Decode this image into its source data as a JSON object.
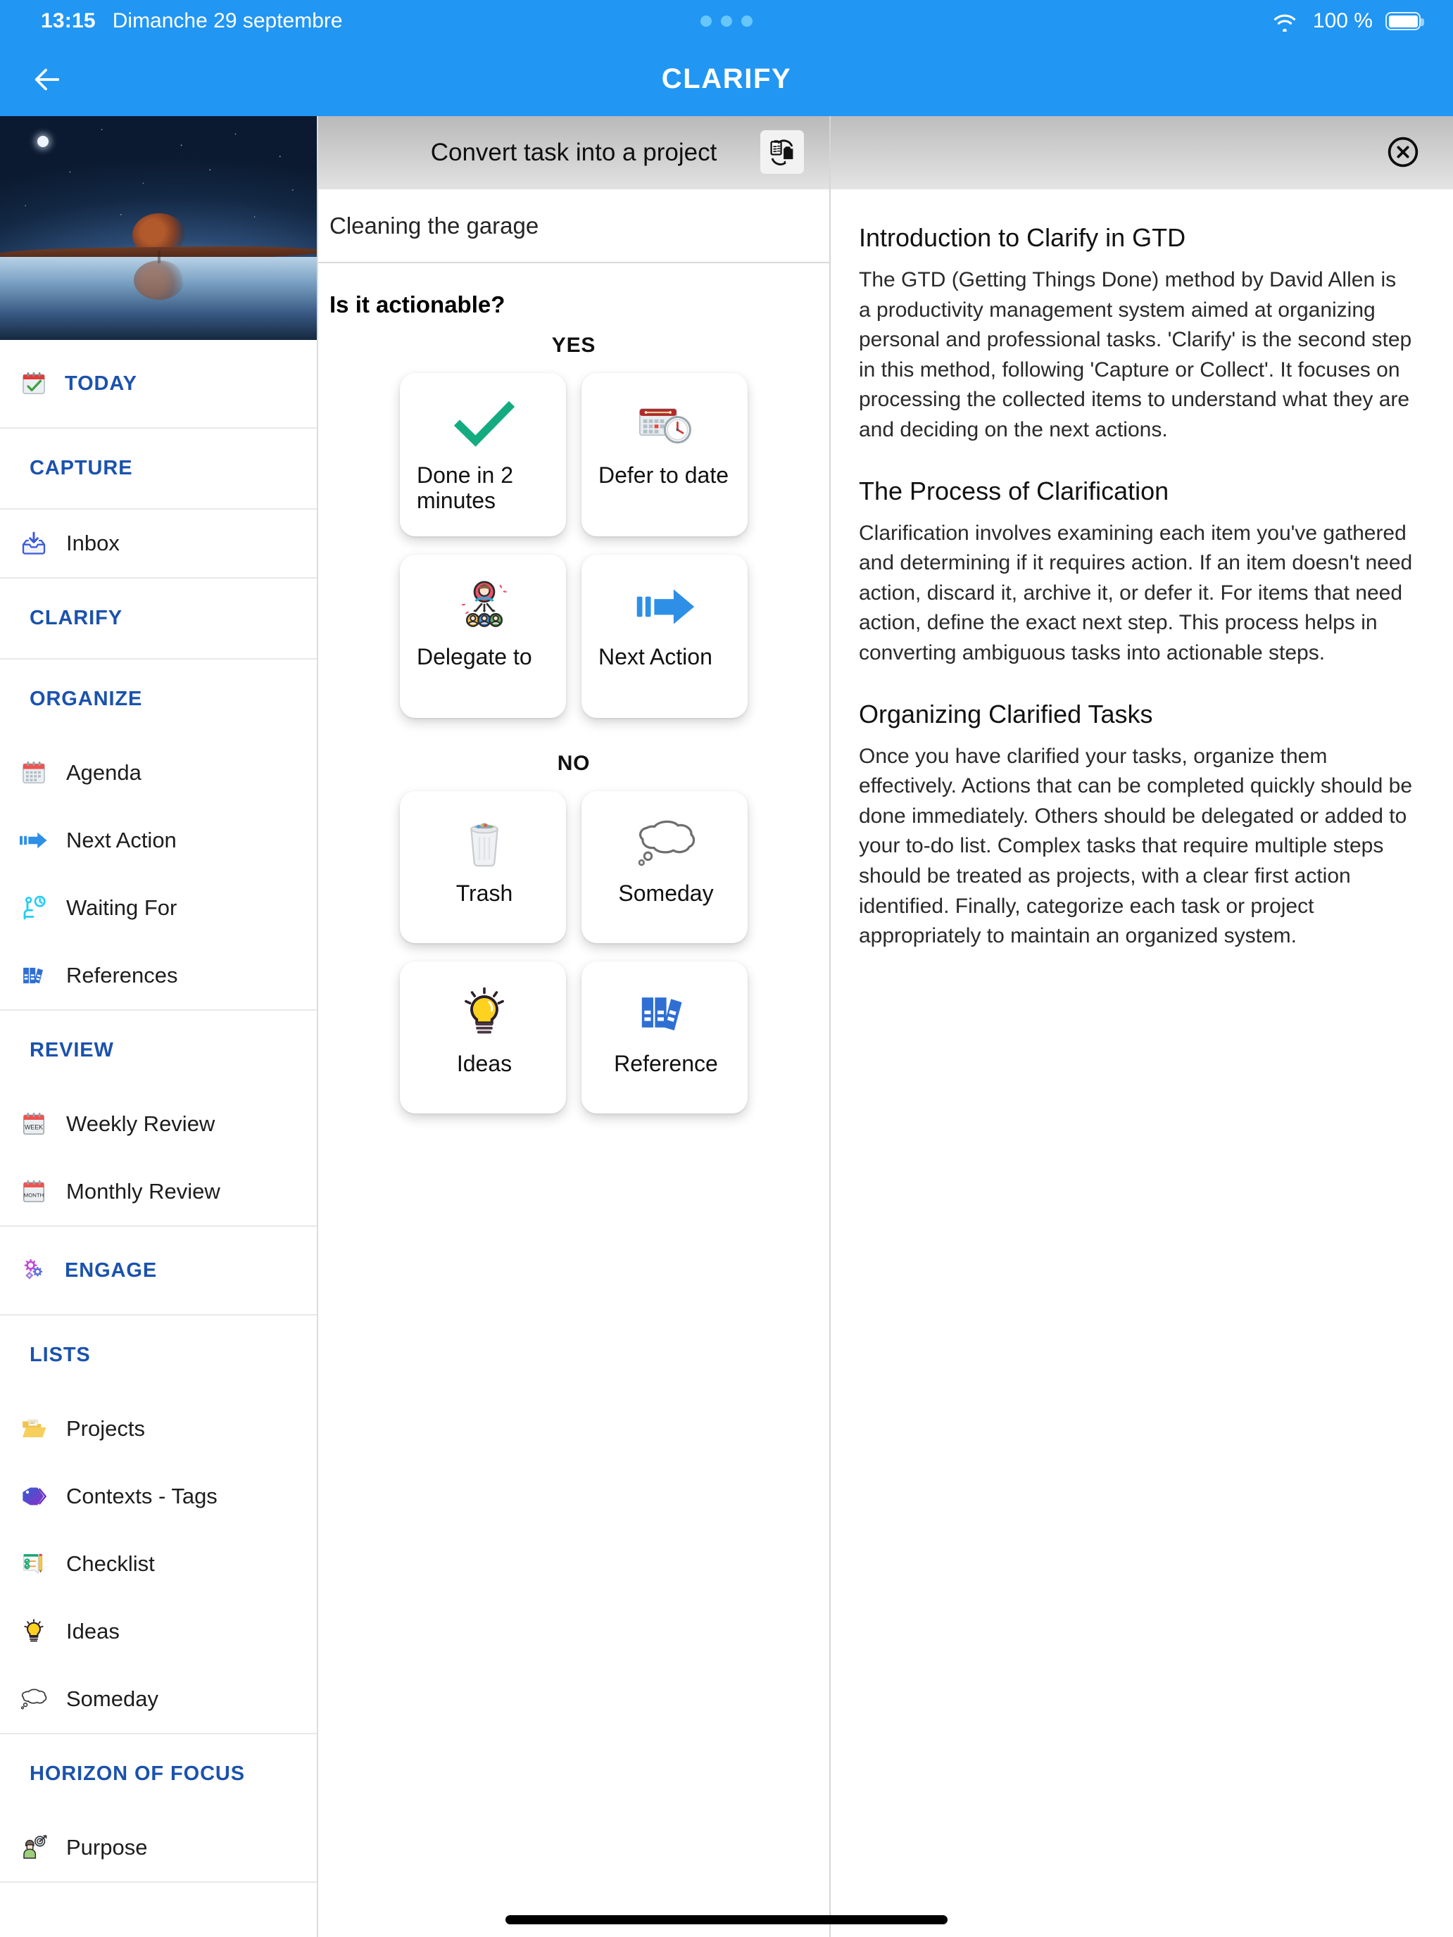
{
  "status_bar": {
    "time": "13:15",
    "date": "Dimanche 29 septembre",
    "battery_percent": "100 %",
    "wifi_icon": "wifi-icon",
    "battery_icon": "battery-full-icon",
    "dots_icon": "loading-dots-icon"
  },
  "app_bar": {
    "title": "CLARIFY",
    "back_icon": "arrow-left-icon"
  },
  "sidebar": {
    "hero_image": "night-tree-reflection-photo",
    "groups": [
      {
        "header": {
          "label": "TODAY",
          "icon": "calendar-check-icon",
          "has_icon": true
        },
        "items": []
      },
      {
        "header": {
          "label": "CAPTURE",
          "icon": null,
          "has_icon": false
        },
        "items": []
      },
      {
        "header": null,
        "items": [
          {
            "label": "Inbox",
            "icon": "inbox-tray-icon"
          }
        ]
      },
      {
        "header": {
          "label": "CLARIFY",
          "icon": null,
          "has_icon": false
        },
        "items": []
      },
      {
        "header": {
          "label": "ORGANIZE",
          "icon": null,
          "has_icon": false
        },
        "items": [
          {
            "label": "Agenda",
            "icon": "calendar-icon"
          },
          {
            "label": "Next Action",
            "icon": "arrow-right-bold-icon"
          },
          {
            "label": "Waiting For",
            "icon": "person-waiting-clock-icon"
          },
          {
            "label": "References",
            "icon": "binders-icon"
          }
        ]
      },
      {
        "header": {
          "label": "REVIEW",
          "icon": null,
          "has_icon": false
        },
        "items": [
          {
            "label": "Weekly Review",
            "icon": "calendar-week-icon"
          },
          {
            "label": "Monthly Review",
            "icon": "calendar-month-icon"
          }
        ]
      },
      {
        "header": {
          "label": "ENGAGE",
          "icon": "gears-icon",
          "has_icon": true
        },
        "items": []
      },
      {
        "header": {
          "label": "LISTS",
          "icon": null,
          "has_icon": false
        },
        "items": [
          {
            "label": "Projects",
            "icon": "open-folder-icon"
          },
          {
            "label": "Contexts - Tags",
            "icon": "tag-icon"
          },
          {
            "label": "Checklist",
            "icon": "checklist-pencil-icon"
          },
          {
            "label": "Ideas",
            "icon": "lightbulb-icon"
          },
          {
            "label": "Someday",
            "icon": "thought-bubble-icon"
          }
        ]
      },
      {
        "header": {
          "label": "HORIZON OF FOCUS",
          "icon": null,
          "has_icon": false
        },
        "items": [
          {
            "label": "Purpose",
            "icon": "person-target-icon"
          }
        ]
      }
    ]
  },
  "middle_panel": {
    "header_title": "Convert task into a project",
    "convert_icon": "convert-task-to-project-icon",
    "task_name": "Cleaning the garage",
    "question": "Is it actionable?",
    "yes_label": "YES",
    "no_label": "NO",
    "yes_cards": [
      {
        "label": "Done in 2 minutes",
        "icon": "green-check-icon"
      },
      {
        "label": "Defer to date",
        "icon": "calendar-clock-icon"
      },
      {
        "label": "Delegate to",
        "icon": "delegate-people-icon"
      },
      {
        "label": "Next Action",
        "icon": "arrow-right-bold-icon"
      }
    ],
    "no_cards": [
      {
        "label": "Trash",
        "icon": "trash-bin-icon"
      },
      {
        "label": "Someday",
        "icon": "thought-bubble-icon"
      },
      {
        "label": "Ideas",
        "icon": "lightbulb-icon"
      },
      {
        "label": "Reference",
        "icon": "binders-icon"
      }
    ]
  },
  "right_panel": {
    "close_icon": "close-circle-icon",
    "sections": [
      {
        "heading": "Introduction to Clarify in GTD",
        "body": "The GTD (Getting Things Done) method by David Allen is a productivity management system aimed at organizing personal and professional tasks. 'Clarify' is the second step in this method, following 'Capture or Collect'. It focuses on processing the collected items to understand what they are and deciding on the next actions."
      },
      {
        "heading": "The Process of Clarification",
        "body": "Clarification involves examining each item you've gathered and determining if it requires action. If an item doesn't need action, discard it, archive it, or defer it. For items that need action, define the exact next step. This process helps in converting ambiguous tasks into actionable steps."
      },
      {
        "heading": "Organizing Clarified Tasks",
        "body": "Once you have clarified your tasks, organize them effectively. Actions that can be completed quickly should be done immediately. Others should be delegated or added to your to-do list. Complex tasks that require multiple steps should be treated as projects, with a clear first action identified. Finally, categorize each task or project appropriately to maintain an organized system."
      }
    ]
  },
  "colors": {
    "accent_blue": "#2196f3",
    "sidebar_heading_blue": "#1b52ad",
    "check_green": "#14ab80",
    "arrow_blue": "#2e8fe6"
  }
}
